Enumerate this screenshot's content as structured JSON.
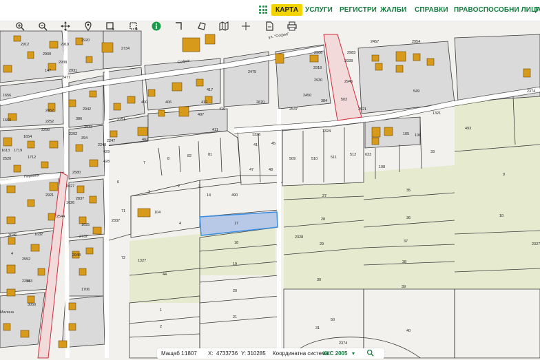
{
  "topnav": {
    "items": [
      "КАРТА",
      "УСЛУГИ",
      "РЕГИСТРИ",
      "ЖАЛБИ",
      "СПРАВКИ",
      "ПРАВОСПОСОБНИ ЛИЦА",
      "Т"
    ],
    "active": "КАРТА"
  },
  "toolbar": {
    "tools": [
      "zoom-in-icon",
      "zoom-out-icon",
      "pan-icon",
      "marker-icon",
      "select-box-icon",
      "select-rect-icon",
      "info-icon",
      "measure-line-icon",
      "measure-area-icon",
      "map-layers-icon",
      "crosshair-icon",
      "document-icon",
      "print-icon"
    ]
  },
  "map": {
    "streets": [
      "ул. \"София\"",
      "София",
      "Перника",
      "Малина"
    ],
    "parcel_numbers": [
      "2912",
      "2910",
      "2920",
      "2909",
      "2734",
      "2996",
      "2906",
      "2983",
      "2457",
      "2954",
      "1",
      "2",
      "147",
      "2931",
      "2938",
      "1656",
      "1660",
      "2452",
      "2477",
      "2252",
      "2256",
      "2202",
      "386",
      "2942",
      "2933",
      "1318",
      "390",
      "1735",
      "400",
      "406",
      "412",
      "2918",
      "2930",
      "2946",
      "502",
      "549",
      "2370",
      "2361",
      "405",
      "407",
      "410",
      "417",
      "2450",
      "384",
      "2251",
      "2928",
      "2921",
      "2547",
      "1654",
      "2248",
      "394",
      "402",
      "411",
      "1326",
      "1324",
      "1321",
      "493",
      "106",
      "105",
      "1613",
      "1712",
      "2520",
      "1719",
      "2247",
      "429",
      "428",
      "41",
      "45",
      "509",
      "510",
      "511",
      "512",
      "633",
      "33",
      "2247",
      "6",
      "7",
      "8",
      "82",
      "81",
      "47",
      "48",
      "108",
      "9",
      "3627",
      "2580",
      "2921",
      "1",
      "2",
      "3",
      "14",
      "490",
      "35",
      "2",
      "2837",
      "3",
      "104",
      "4",
      "5",
      "27",
      "2337",
      "1625",
      "1632",
      "1626",
      "2544",
      "71",
      "17",
      "28",
      "36",
      "10",
      "3036",
      "2732",
      "1327",
      "72",
      "18",
      "2328",
      "29",
      "37",
      "4",
      "2552",
      "2948",
      "1706",
      "2837",
      "44",
      "19",
      "30",
      "38",
      "2234",
      "963",
      "1",
      "20",
      "39",
      "2",
      "3050",
      "1",
      "21",
      "31",
      "50",
      "40",
      "2374"
    ],
    "selected_parcel": "17",
    "colors": {
      "parcel_fill": "#dadada",
      "building_fill": "#d79a1a",
      "agricultural_fill": "#e6ebcf",
      "selected_fill": "#b8c9e8",
      "selected_stroke": "#3b8ee0",
      "restricted_stroke": "#d22c3c"
    }
  },
  "status": {
    "scale_label": "Мащаб 1:",
    "scale_value": "1807",
    "x_label": "X:",
    "x_value": "4733736",
    "y_label": "Y:",
    "y_value": "310285",
    "coord_label": "Координатна система:",
    "coord_value": "ККС 2005"
  }
}
